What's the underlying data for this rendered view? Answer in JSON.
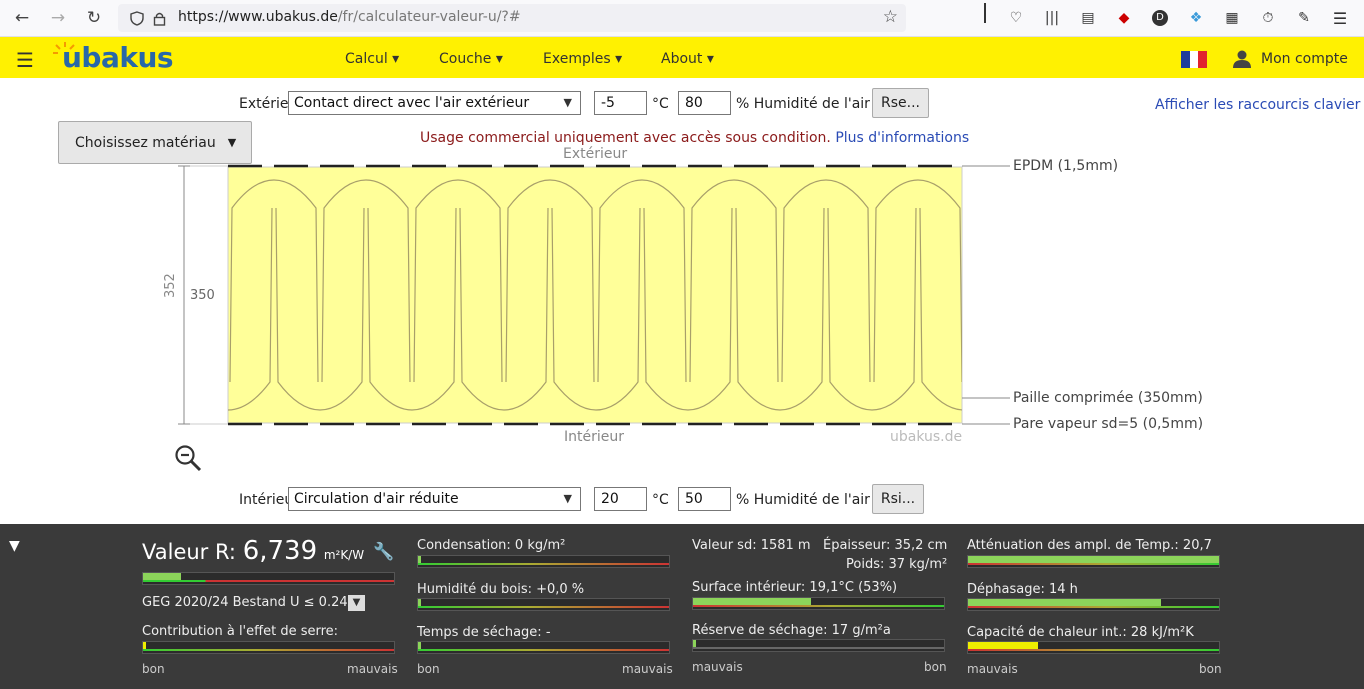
{
  "browser": {
    "url_domain": "https://www.ubakus.de",
    "url_path": "/fr/calculateur-valeur-u/?#"
  },
  "header": {
    "logo": "ubakus",
    "menu": [
      {
        "label": "Calcul ▾"
      },
      {
        "label": "Couche ▾"
      },
      {
        "label": "Exemples ▾"
      },
      {
        "label": "About ▾"
      }
    ],
    "account": "Mon compte"
  },
  "exterior": {
    "label": "Extérieu",
    "condition": "Contact direct avec l'air extérieur",
    "temp": "-5",
    "temp_unit": "°C",
    "humidity": "80",
    "humidity_label": "% Humidité de l'air",
    "rse_button": "Rse..."
  },
  "interior": {
    "label": "Intérieu",
    "condition": "Circulation d'air réduite",
    "temp": "20",
    "temp_unit": "°C",
    "humidity": "50",
    "humidity_label": "% Humidité de l'air",
    "rsi_button": "Rsi..."
  },
  "shortcuts_link": "Afficher les raccourcis clavier",
  "material_button": "Choisissez matériau",
  "notice": {
    "text": "Usage commercial uniquement avec accès sous condition.",
    "link": "Plus d'informations"
  },
  "diagram": {
    "top_label": "Extérieur",
    "bottom_label": "Intérieur",
    "watermark": "ubakus.de",
    "total_thickness": "352",
    "layer_thickness": "350",
    "layers": [
      {
        "label": "EPDM (1,5mm)"
      },
      {
        "label": "Paille comprimée (350mm)"
      },
      {
        "label": "Pare vapeur sd=5 (0,5mm)"
      }
    ],
    "colors": {
      "insulation": "#ffff99",
      "hatch": "#a89f6a"
    }
  },
  "results": {
    "r_label": "Valeur R:",
    "r_value": "6,739",
    "r_unit": "m²K/W",
    "r_fill": 0.15,
    "standard": "GEG 2020/24 Bestand U ≤ 0.24",
    "greenhouse": "Contribution à l'effet de serre:",
    "greenhouse_fill": 0.01,
    "condensation": "Condensation: 0 kg/m²",
    "condensation_fill": 0.0,
    "wood_humidity": "Humidité du bois: +0,0 %",
    "wood_humidity_fill": 0.0,
    "drying_time": "Temps de séchage: -",
    "drying_time_fill": 0.0,
    "sd_value": "Valeur sd: 1581 m",
    "thickness": "Épaisseur: 35,2 cm",
    "weight": "Poids: 37 kg/m²",
    "surface_interior": "Surface intérieur: 19,1°C (53%)",
    "surface_fill": 0.47,
    "drying_reserve": "Réserve de séchage: 17 g/m²a",
    "drying_reserve_fill": 0.0,
    "attenuation": "Atténuation des ampl. de Temp.: 20,7",
    "attenuation_fill": 1.0,
    "phase_shift": "Déphasage: 14 h",
    "phase_shift_fill": 0.77,
    "heat_capacity": "Capacité de chaleur int.: 28 kJ/m²K",
    "heat_capacity_fill": 0.28,
    "good": "bon",
    "bad": "mauvais"
  }
}
